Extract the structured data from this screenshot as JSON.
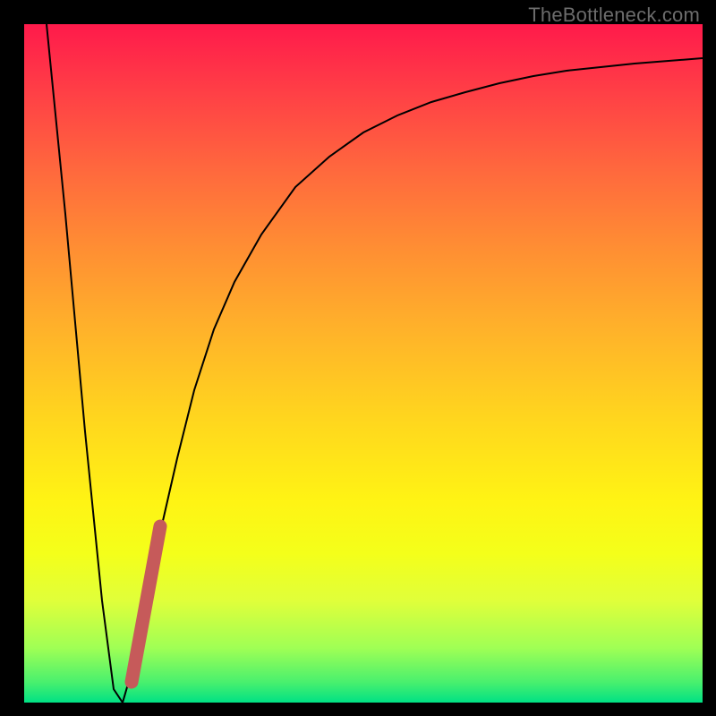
{
  "watermark": "TheBottleneck.com",
  "colors": {
    "page_bg": "#000000",
    "watermark_text": "#6c6c6c",
    "gradient_top": "#ff1a4b",
    "gradient_bottom": "#00e184",
    "curve": "#000000",
    "marker": "#c65a5a"
  },
  "chart_data": {
    "type": "line",
    "title": "",
    "xlabel": "",
    "ylabel": "",
    "xlim": [
      0,
      100
    ],
    "ylim": [
      0,
      100
    ],
    "grid": false,
    "series": [
      {
        "name": "curve",
        "x": [
          3.3,
          6,
          9,
          11.5,
          13.2,
          14.5,
          16,
          18,
          20,
          22.5,
          25,
          28,
          31,
          35,
          40,
          45,
          50,
          55,
          60,
          65,
          70,
          75,
          80,
          85,
          90,
          95,
          100
        ],
        "y": [
          100,
          72,
          40,
          15,
          2,
          0,
          5,
          15,
          25,
          36,
          46,
          55,
          62,
          69,
          76,
          80.5,
          84,
          86.5,
          88.5,
          90,
          91.3,
          92.3,
          93.1,
          93.7,
          94.2,
          94.6,
          95
        ]
      },
      {
        "name": "marker",
        "x": [
          15.8,
          20.1
        ],
        "y": [
          3,
          26
        ]
      }
    ],
    "annotations": []
  }
}
